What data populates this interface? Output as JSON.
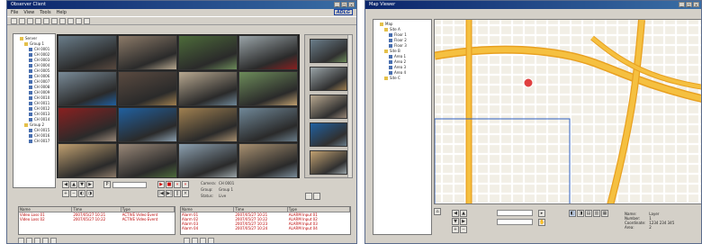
{
  "left_window": {
    "title": "Observer Client",
    "logo": "ADLG",
    "menu": [
      "File",
      "View",
      "Tools",
      "Help"
    ],
    "tree": [
      {
        "level": 0,
        "label": "Server"
      },
      {
        "level": 1,
        "label": "Group 1"
      },
      {
        "level": 2,
        "label": "CH 0001"
      },
      {
        "level": 2,
        "label": "CH 0002"
      },
      {
        "level": 2,
        "label": "CH 0003"
      },
      {
        "level": 2,
        "label": "CH 0004"
      },
      {
        "level": 2,
        "label": "CH 0005"
      },
      {
        "level": 2,
        "label": "CH 0006"
      },
      {
        "level": 2,
        "label": "CH 0007"
      },
      {
        "level": 2,
        "label": "CH 0008"
      },
      {
        "level": 2,
        "label": "CH 0009"
      },
      {
        "level": 2,
        "label": "CH 0010"
      },
      {
        "level": 2,
        "label": "CH 0011"
      },
      {
        "level": 2,
        "label": "CH 0012"
      },
      {
        "level": 2,
        "label": "CH 0013"
      },
      {
        "level": 2,
        "label": "CH 0014"
      },
      {
        "level": 1,
        "label": "Group 2"
      },
      {
        "level": 2,
        "label": "CH 0015"
      },
      {
        "level": 2,
        "label": "CH 0016"
      },
      {
        "level": 2,
        "label": "CH 0017"
      }
    ],
    "event_rows": [
      {
        "name": "Video Loss 01",
        "time": "2007/05/27 10:21",
        "type": "ACTIVE Video Event"
      },
      {
        "name": "Video Loss 02",
        "time": "2007/05/27 10:22",
        "type": "ACTIVE Video Event"
      }
    ],
    "alarm_rows": [
      {
        "name": "Alarm 01",
        "time": "2007/05/27 10:21",
        "type": "ALARM Input 01"
      },
      {
        "name": "Alarm 02",
        "time": "2007/05/27 10:22",
        "type": "ALARM Input 02"
      },
      {
        "name": "Alarm 03",
        "time": "2007/05/27 10:23",
        "type": "ALARM Input 03"
      },
      {
        "name": "Alarm 04",
        "time": "2007/05/27 10:24",
        "type": "ALARM Input 04"
      }
    ],
    "event_headers": [
      "Name",
      "Time",
      "Type"
    ],
    "status_labels": [
      "Camera:",
      "Group:",
      "Status:"
    ],
    "status_values": [
      "CH 0001",
      "Group 1",
      "Live"
    ]
  },
  "right_window": {
    "title": "Map Viewer",
    "tree": [
      {
        "level": 0,
        "label": "Map"
      },
      {
        "level": 1,
        "label": "Site A"
      },
      {
        "level": 2,
        "label": "Floor 1"
      },
      {
        "level": 2,
        "label": "Floor 2"
      },
      {
        "level": 2,
        "label": "Floor 3"
      },
      {
        "level": 1,
        "label": "Site B"
      },
      {
        "level": 2,
        "label": "Area 1"
      },
      {
        "level": 2,
        "label": "Area 2"
      },
      {
        "level": 2,
        "label": "Area 3"
      },
      {
        "level": 2,
        "label": "Area 4"
      },
      {
        "level": 1,
        "label": "Site C"
      }
    ],
    "info": [
      {
        "label": "Name:",
        "value": "Layer"
      },
      {
        "label": "Number:",
        "value": "1"
      },
      {
        "label": "Coordinate:",
        "value": "1234 234 345"
      },
      {
        "label": "Area:",
        "value": "2"
      }
    ]
  },
  "colors": {
    "titlebar": "#0a246a",
    "window_bg": "#d4d0c8",
    "map_bg": "#f2efe6",
    "highway": "#f5c040",
    "map_selection": "#3060c0"
  }
}
